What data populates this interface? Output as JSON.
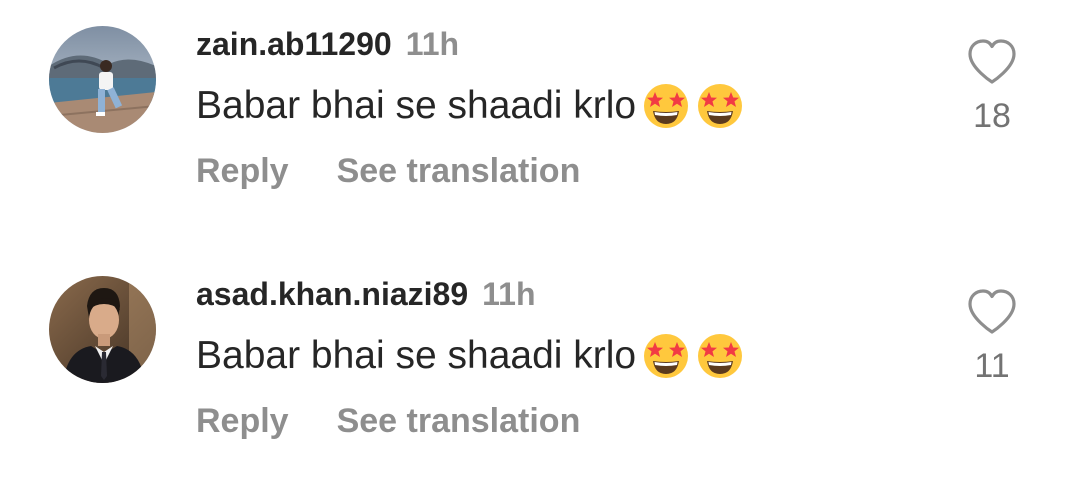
{
  "comments": [
    {
      "username": "zain.ab11290",
      "time": "11h",
      "text": "Babar bhai se shaadi krlo",
      "emojis": [
        "star-struck",
        "star-struck"
      ],
      "reply_label": "Reply",
      "translate_label": "See translation",
      "likes": "18"
    },
    {
      "username": "asad.khan.niazi89",
      "time": "11h",
      "text": "Babar bhai se shaadi krlo",
      "emojis": [
        "star-struck",
        "star-struck"
      ],
      "reply_label": "Reply",
      "translate_label": "See translation",
      "likes": "11"
    }
  ],
  "colors": {
    "primary_text": "#262626",
    "secondary_text": "#8e8e8e",
    "emoji_face": "#ffc83d",
    "emoji_star": "#f23a44"
  }
}
